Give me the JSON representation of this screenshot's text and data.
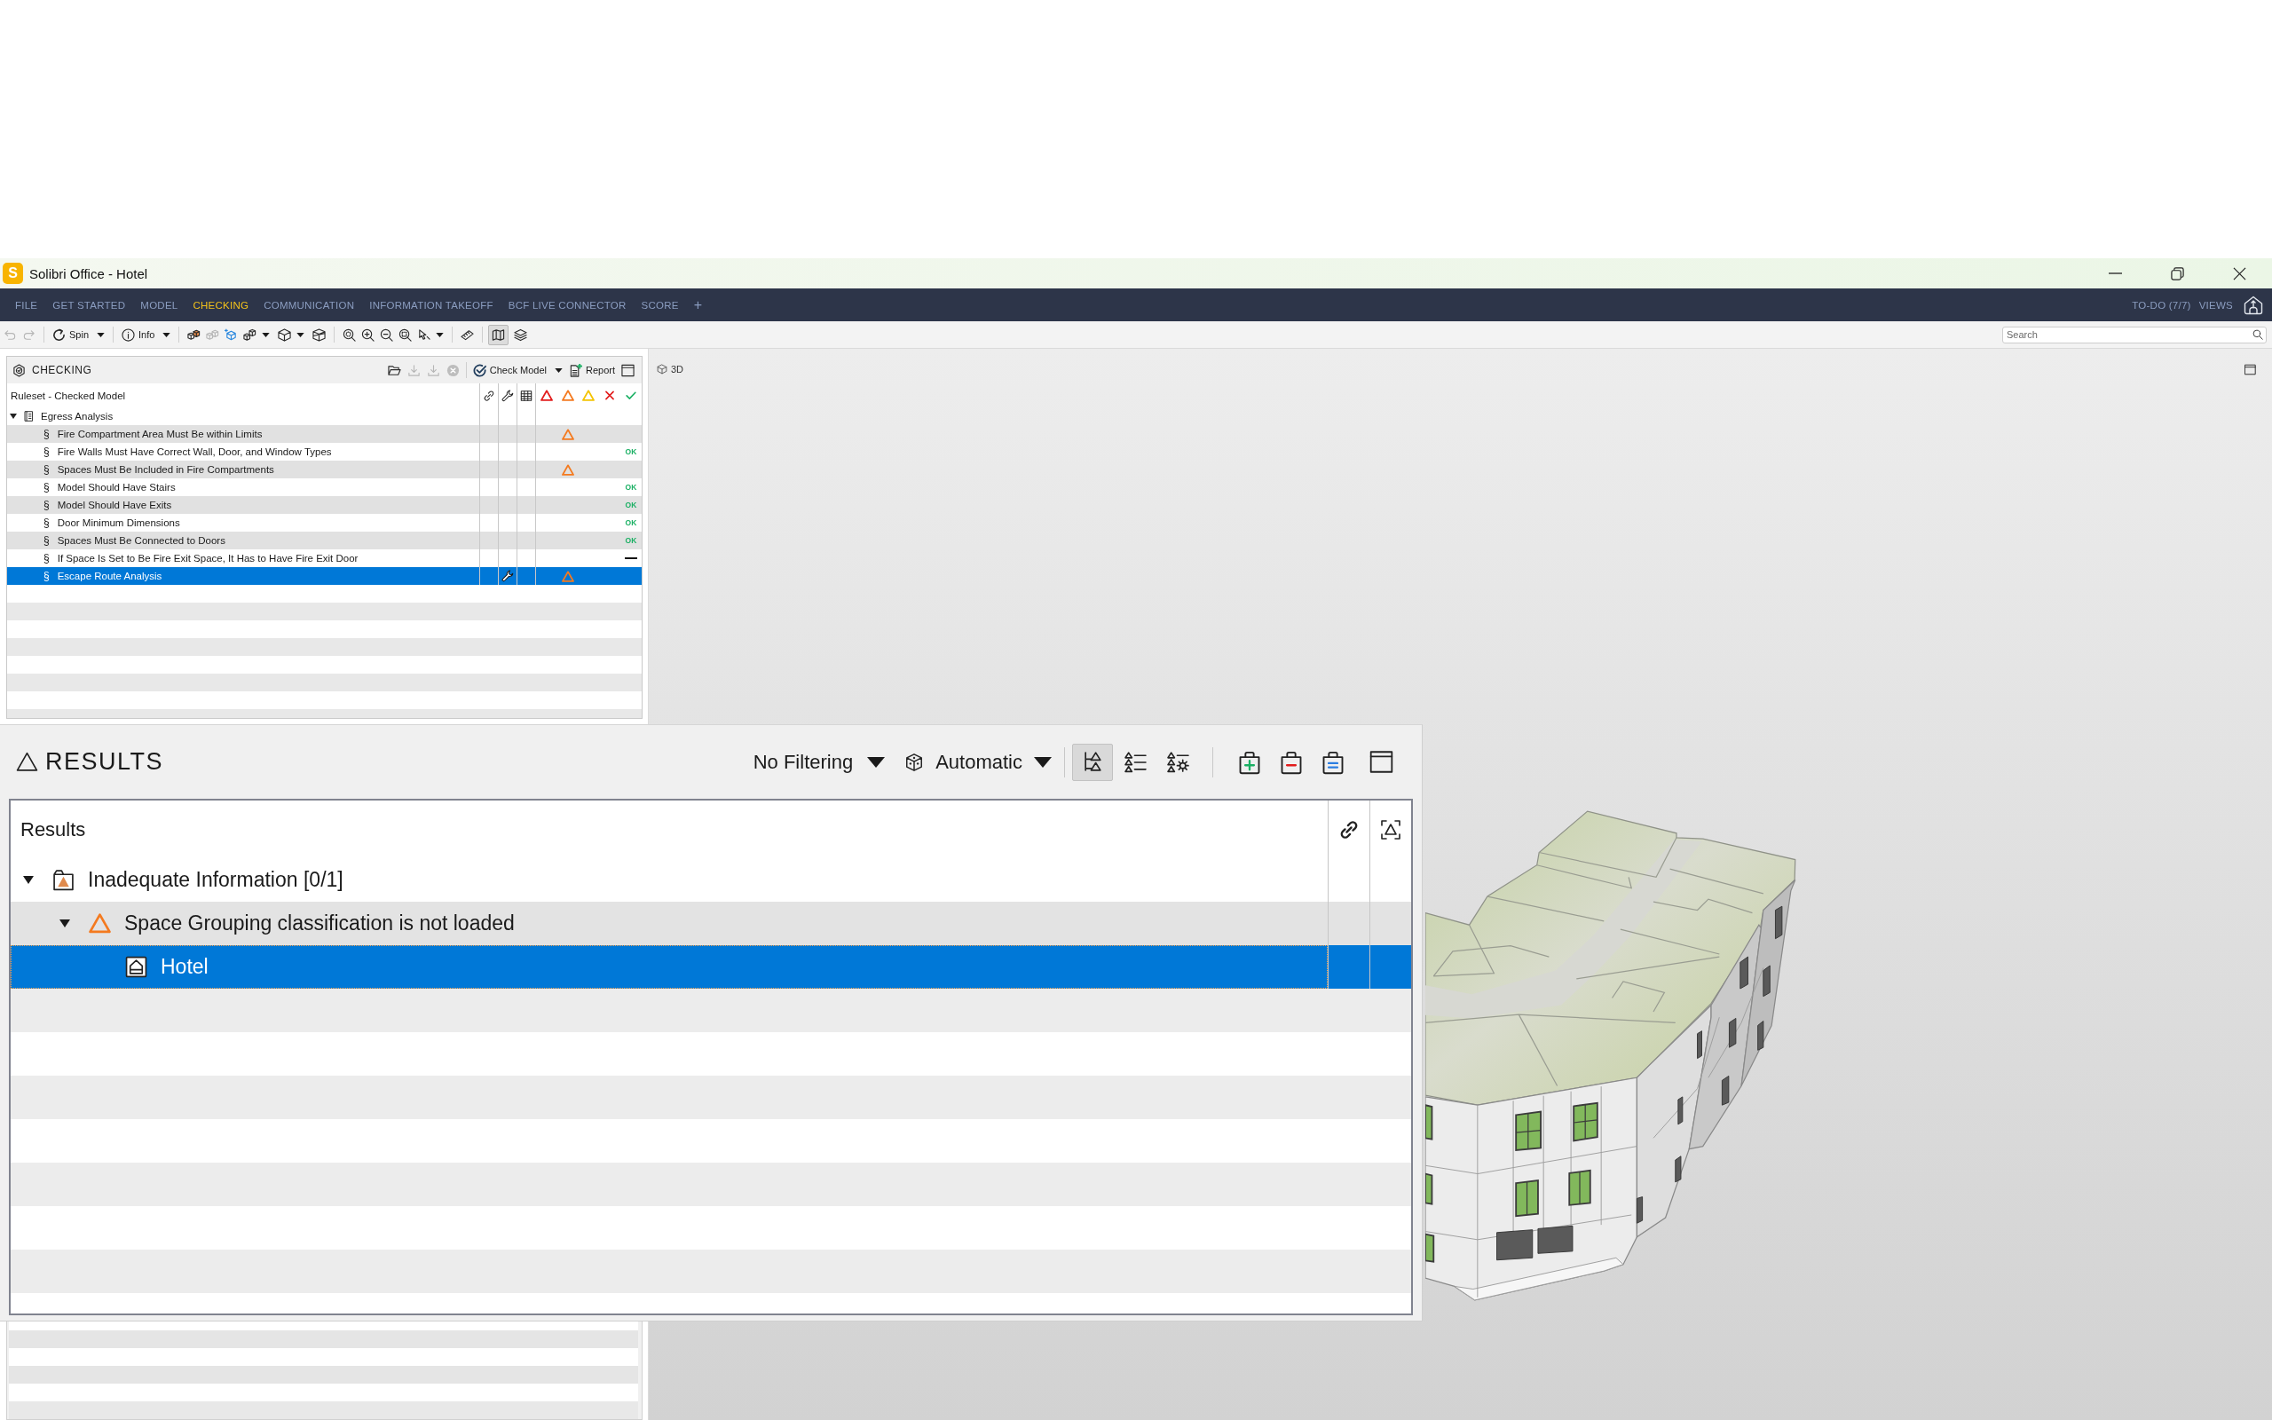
{
  "window": {
    "logo": "S",
    "title": "Solibri Office - Hotel"
  },
  "menu_bar": {
    "tabs": [
      {
        "label": "FILE",
        "selected": false
      },
      {
        "label": "GET STARTED",
        "selected": false
      },
      {
        "label": "MODEL",
        "selected": false
      },
      {
        "label": "CHECKING",
        "selected": true
      },
      {
        "label": "COMMUNICATION",
        "selected": false
      },
      {
        "label": "INFORMATION TAKEOFF",
        "selected": false
      },
      {
        "label": "BCF LIVE CONNECTOR",
        "selected": false
      },
      {
        "label": "SCORE",
        "selected": false
      }
    ],
    "add_tab": "+",
    "todo": "TO-DO (7/7)",
    "views": "VIEWS"
  },
  "toolbar": {
    "undo": {
      "disabled": true
    },
    "redo": {
      "disabled": true
    },
    "spin": {
      "label": "Spin"
    },
    "info": {
      "label": "Info"
    },
    "map_toggle": {
      "pressed": true
    },
    "search": {
      "placeholder": "Search"
    }
  },
  "checking_panel": {
    "title": "CHECKING",
    "file_tools": [
      {
        "disabled": false
      },
      {
        "disabled": true
      },
      {
        "disabled": true
      },
      {
        "disabled": true
      }
    ],
    "check_model": {
      "label": "Check Model"
    },
    "report": {
      "label": "Report"
    },
    "column_header": "Ruleset - Checked Model",
    "ruleset": {
      "name": "Egress Analysis",
      "expanded": true,
      "rules": [
        {
          "symbol": "§",
          "name": "Fire Compartment Area Must Be within Limits",
          "kind": "moderate",
          "selected": false,
          "flagged": false
        },
        {
          "symbol": "§",
          "name": "Fire Walls Must Have Correct Wall, Door, and Window Types",
          "kind": "passed",
          "status_text": "OK",
          "selected": false,
          "flagged": false
        },
        {
          "symbol": "§",
          "name": "Spaces Must Be Included in Fire Compartments",
          "kind": "moderate",
          "selected": false,
          "flagged": false
        },
        {
          "symbol": "§",
          "name": "Model Should Have Stairs",
          "kind": "passed",
          "status_text": "OK",
          "selected": false,
          "flagged": false
        },
        {
          "symbol": "§",
          "name": "Model Should Have Exits",
          "kind": "passed",
          "status_text": "OK",
          "selected": false,
          "flagged": false
        },
        {
          "symbol": "§",
          "name": "Door Minimum Dimensions",
          "kind": "passed",
          "status_text": "OK",
          "selected": false,
          "flagged": false
        },
        {
          "symbol": "§",
          "name": "Spaces Must Be Connected to Doors",
          "kind": "passed",
          "status_text": "OK",
          "selected": false,
          "flagged": false
        },
        {
          "symbol": "§",
          "name": "If Space Is Set to Be Fire Exit Space, It Has to Have Fire Exit Door",
          "kind": "unchecked",
          "selected": false,
          "flagged": false
        },
        {
          "symbol": "§",
          "name": "Escape Route Analysis",
          "kind": "moderate",
          "selected": true,
          "flagged": true
        }
      ]
    }
  },
  "view_3d": {
    "title": "3D"
  },
  "results_panel": {
    "title": "RESULTS",
    "filter": {
      "label": "No Filtering"
    },
    "mode": {
      "label": "Automatic"
    },
    "view_modes": [
      {
        "selected": true
      },
      {
        "selected": false
      },
      {
        "selected": false
      }
    ],
    "column_header": "Results",
    "tree": [
      {
        "kind": "category",
        "label": "Inadequate Information [0/1]",
        "expanded": true,
        "selected": false,
        "children": [
          {
            "kind": "issue",
            "label": "Space Grouping classification is not loaded",
            "expanded": true,
            "selected": false,
            "children": [
              {
                "kind": "model",
                "label": "Hotel",
                "selected": true
              }
            ]
          }
        ]
      }
    ]
  }
}
